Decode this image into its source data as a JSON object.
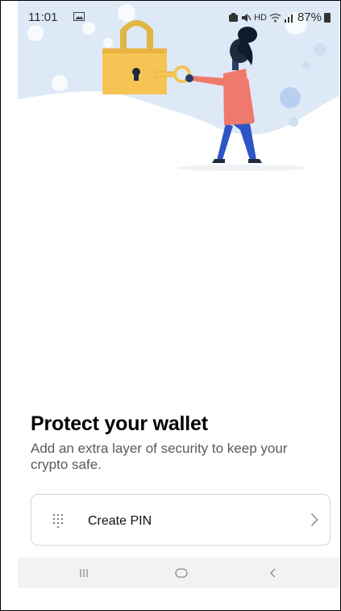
{
  "status_bar": {
    "time": "11:01",
    "hd": "HD",
    "battery": "87%",
    "icons": [
      "image-icon",
      "alarm-icon",
      "mute-icon",
      "wifi-icon",
      "signal-icon",
      "battery-icon"
    ]
  },
  "illustration": {
    "icons": [
      "padlock-icon",
      "key-icon",
      "person-illustration"
    ],
    "colors": {
      "sky": "#dde9f6",
      "lock": "#f6c454",
      "shirt": "#ef7a6b",
      "pants": "#2e55c6",
      "hair": "#0d1b2a"
    }
  },
  "main": {
    "title": "Protect your wallet",
    "subtitle": "Add an extra layer of security to keep your crypto safe."
  },
  "pin_option": {
    "label": "Create PIN",
    "icon": "keypad-icon",
    "chevron": "chevron-right-icon"
  },
  "nav_bar": {
    "icons": [
      "recent-apps-icon",
      "home-icon",
      "back-icon"
    ]
  }
}
